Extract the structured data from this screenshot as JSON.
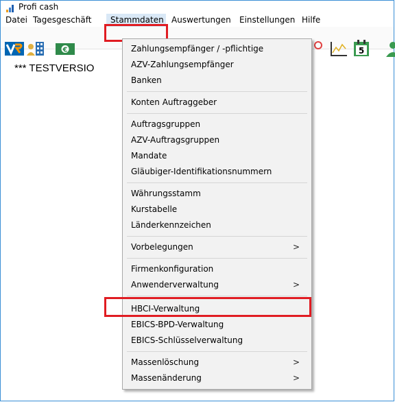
{
  "window": {
    "title": "Profi cash"
  },
  "menubar": {
    "items": [
      {
        "label": "Datei"
      },
      {
        "label": "Tagesgeschäft"
      },
      {
        "label": "Stammdaten"
      },
      {
        "label": "Auswertungen"
      },
      {
        "label": "Einstellungen"
      },
      {
        "label": "Hilfe"
      }
    ]
  },
  "toolbar": {
    "icons": [
      "volksbank-logo-icon",
      "person-building-icon",
      "euro-banknote-icon",
      "chart-icon",
      "line-chart-icon",
      "calendar-5-icon",
      "user-icon"
    ],
    "calendar_day": "5"
  },
  "content": {
    "version_text": "*** TESTVERSIO"
  },
  "dropdown": {
    "items": [
      {
        "label": "Zahlungsempfänger / -pflichtige"
      },
      {
        "label": "AZV-Zahlungsempfänger"
      },
      {
        "label": "Banken"
      },
      {
        "label": "Konten Auftraggeber"
      },
      {
        "label": "Auftragsgruppen"
      },
      {
        "label": "AZV-Auftragsgruppen"
      },
      {
        "label": "Mandate"
      },
      {
        "label": "Gläubiger-Identifikationsnummern"
      },
      {
        "label": "Währungsstamm"
      },
      {
        "label": "Kurstabelle"
      },
      {
        "label": "Länderkennzeichen"
      },
      {
        "label": "Vorbelegungen",
        "arrow": ">"
      },
      {
        "label": "Firmenkonfiguration"
      },
      {
        "label": "Anwenderverwaltung",
        "arrow": ">"
      },
      {
        "label": "HBCI-Verwaltung"
      },
      {
        "label": "EBICS-BPD-Verwaltung"
      },
      {
        "label": "EBICS-Schlüsselverwaltung"
      },
      {
        "label": "Massenlöschung",
        "arrow": ">"
      },
      {
        "label": "Massenänderung",
        "arrow": ">"
      }
    ]
  },
  "colors": {
    "highlight": "#e01c22",
    "window_border": "#3a8fd6",
    "menu_background": "#f2f2f2"
  }
}
